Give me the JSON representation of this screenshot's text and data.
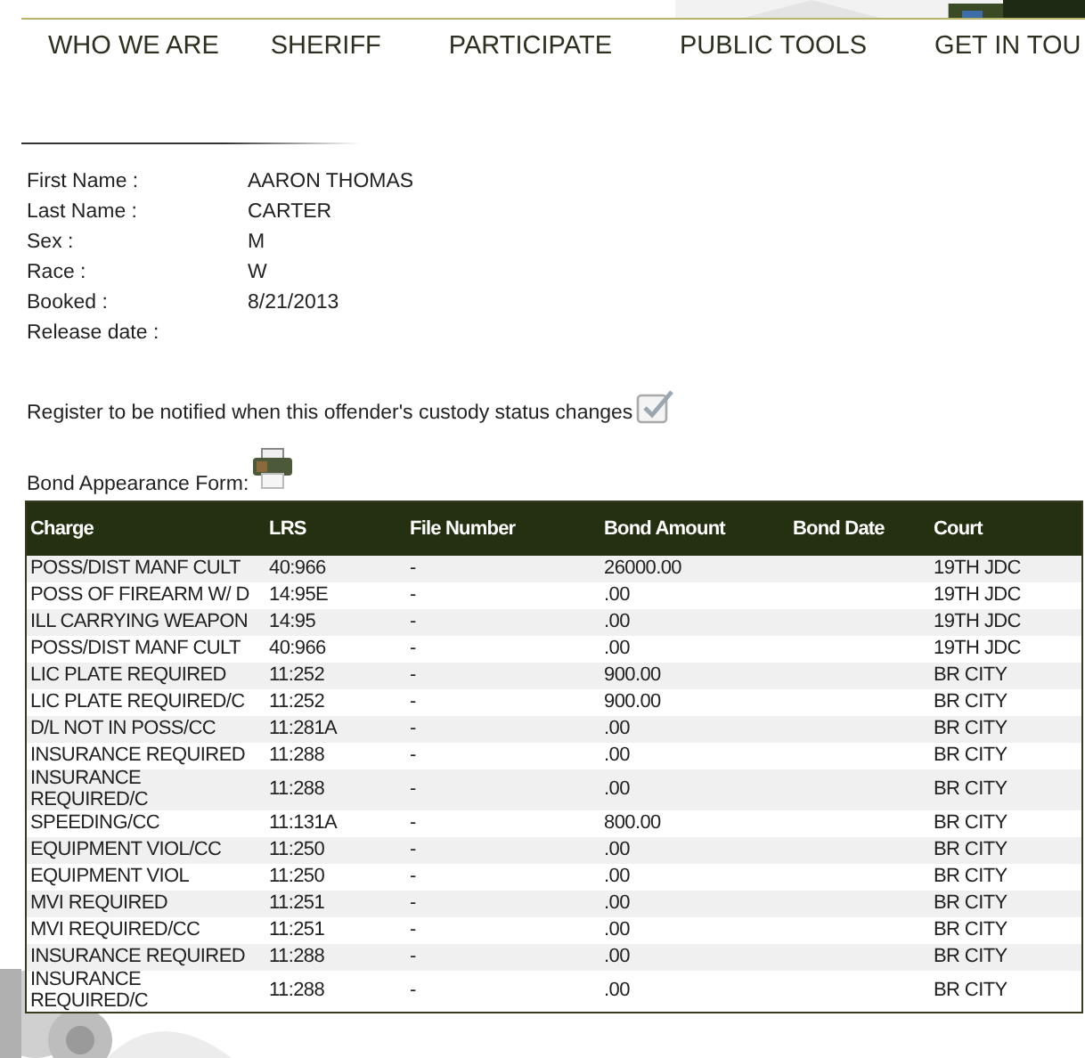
{
  "nav": [
    {
      "label": "WHO WE ARE"
    },
    {
      "label": "SHERIFF"
    },
    {
      "label": "PARTICIPATE"
    },
    {
      "label": "PUBLIC TOOLS"
    },
    {
      "label": "GET IN TOU"
    }
  ],
  "details": [
    {
      "label": "First Name :",
      "value": "AARON THOMAS"
    },
    {
      "label": "Last Name :",
      "value": "CARTER"
    },
    {
      "label": "Sex :",
      "value": "M"
    },
    {
      "label": "Race :",
      "value": "W"
    },
    {
      "label": "Booked :",
      "value": "8/21/2013"
    },
    {
      "label": "Release date :"
    }
  ],
  "notify": {
    "text": "Register to be notified when this offender's custody status changes"
  },
  "bond_form": {
    "label": "Bond Appearance Form:"
  },
  "table": {
    "columns": [
      "Charge",
      "LRS",
      "File Number",
      "Bond Amount",
      "Bond Date",
      "Court"
    ],
    "rows": [
      [
        "POSS/DIST MANF CULT",
        "40:966",
        "-",
        "26000.00",
        "",
        "19TH JDC"
      ],
      [
        "POSS OF FIREARM W/ D",
        "14:95E",
        "-",
        ".00",
        "",
        "19TH JDC"
      ],
      [
        "ILL CARRYING WEAPON",
        "14:95",
        "-",
        ".00",
        "",
        "19TH JDC"
      ],
      [
        "POSS/DIST MANF CULT",
        "40:966",
        "-",
        ".00",
        "",
        "19TH JDC"
      ],
      [
        "LIC PLATE REQUIRED",
        "11:252",
        "-",
        "900.00",
        "",
        "BR CITY"
      ],
      [
        "LIC PLATE REQUIRED/C",
        "11:252",
        "-",
        "900.00",
        "",
        "BR CITY"
      ],
      [
        "D/L NOT IN POSS/CC",
        "11:281A",
        "-",
        ".00",
        "",
        "BR CITY"
      ],
      [
        "INSURANCE REQUIRED",
        "11:288",
        "-",
        ".00",
        "",
        "BR CITY"
      ],
      [
        "INSURANCE REQUIRED/C",
        "11:288",
        "-",
        ".00",
        "",
        "BR CITY"
      ],
      [
        "SPEEDING/CC",
        "11:131A",
        "-",
        "800.00",
        "",
        "BR CITY"
      ],
      [
        "EQUIPMENT VIOL/CC",
        "11:250",
        "-",
        ".00",
        "",
        "BR CITY"
      ],
      [
        "EQUIPMENT VIOL",
        "11:250",
        "-",
        ".00",
        "",
        "BR CITY"
      ],
      [
        "MVI REQUIRED",
        "11:251",
        "-",
        ".00",
        "",
        "BR CITY"
      ],
      [
        "MVI REQUIRED/CC",
        "11:251",
        "-",
        ".00",
        "",
        "BR CITY"
      ],
      [
        "INSURANCE REQUIRED",
        "11:288",
        "-",
        ".00",
        "",
        "BR CITY"
      ],
      [
        "INSURANCE REQUIRED/C",
        "11:288",
        "-",
        ".00",
        "",
        "BR CITY"
      ]
    ]
  }
}
